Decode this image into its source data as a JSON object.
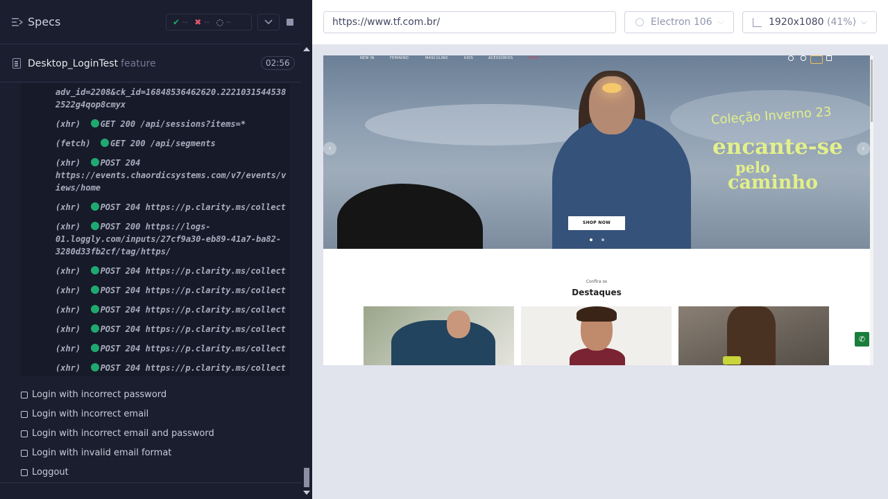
{
  "reporter": {
    "title": "Specs",
    "stats": {
      "passed": "--",
      "failed": "--",
      "pending": "--"
    },
    "spec": {
      "name": "Desktop_LoginTest",
      "kind": "feature",
      "time": "02:56"
    },
    "log_lines": [
      {
        "text": "adv_id=2208&ck_id=16848536462620.2221031544538",
        "dot": false
      },
      {
        "text": "2522g4qop8cmyx",
        "dot": false
      },
      {
        "prefix": "(xhr)  ",
        "text": "GET 200 /api/sessions?items=*",
        "dot": true
      },
      {
        "prefix": "(fetch)  ",
        "text": "GET 200 /api/segments",
        "dot": true
      },
      {
        "prefix": "(xhr)  ",
        "text": "POST 204",
        "dot": true
      },
      {
        "text": "https://events.chaordicsystems.com/v7/events/v",
        "dot": false
      },
      {
        "text": "iews/home",
        "dot": false
      },
      {
        "prefix": "(xhr)  ",
        "text": "POST 204 https://p.clarity.ms/collect",
        "dot": true
      },
      {
        "prefix": "(xhr)  ",
        "text": "POST 200 https://logs-",
        "dot": true
      },
      {
        "text": "01.loggly.com/inputs/27cf9a30-eb89-41a7-ba82-",
        "dot": false
      },
      {
        "text": "3280d33fb2cf/tag/https/",
        "dot": false
      },
      {
        "prefix": "(xhr)  ",
        "text": "POST 204 https://p.clarity.ms/collect",
        "dot": true
      },
      {
        "prefix": "(xhr)  ",
        "text": "POST 204 https://p.clarity.ms/collect",
        "dot": true
      },
      {
        "prefix": "(xhr)  ",
        "text": "POST 204 https://p.clarity.ms/collect",
        "dot": true
      },
      {
        "prefix": "(xhr)  ",
        "text": "POST 204 https://p.clarity.ms/collect",
        "dot": true
      },
      {
        "prefix": "(xhr)  ",
        "text": "POST 204 https://p.clarity.ms/collect",
        "dot": true
      },
      {
        "prefix": "(xhr)  ",
        "text": "POST 204 https://p.clarity.ms/collect",
        "dot": true
      }
    ],
    "tests": [
      "Login with incorrect password",
      "Login with incorrect email",
      "Login with incorrect email and password",
      "Login with invalid email format",
      "Loggout"
    ]
  },
  "aut": {
    "url": "https://www.tf.com.br/",
    "browser": "Electron 106",
    "viewport": "1920x1080",
    "zoom": "(41%)"
  },
  "site": {
    "nav": [
      "NEW IN",
      "FEMININO",
      "MASCULINO",
      "KIDS",
      "ACESSÓRIOS",
      "SALE"
    ],
    "promo_line1": "Coleção Inverno 23",
    "promo_line2": "encante-se",
    "promo_line3": "pelo",
    "promo_line4": "caminho",
    "shop_button": "SHOP NOW",
    "kicker": "Confira os",
    "section_title": "Destaques",
    "arrow_prev": "‹",
    "arrow_next": "›"
  },
  "colors": {
    "reporter_bg": "#1b1e2e",
    "pass": "#1fa971",
    "fail": "#e45770",
    "promo": "#e3f08a",
    "sale": "#e04060"
  },
  "icons": {
    "specs": "specs-list-icon",
    "spec_file": "document-icon",
    "browser": "electron-icon",
    "viewport": "ruler-icon",
    "whatsapp": "whatsapp-icon"
  }
}
